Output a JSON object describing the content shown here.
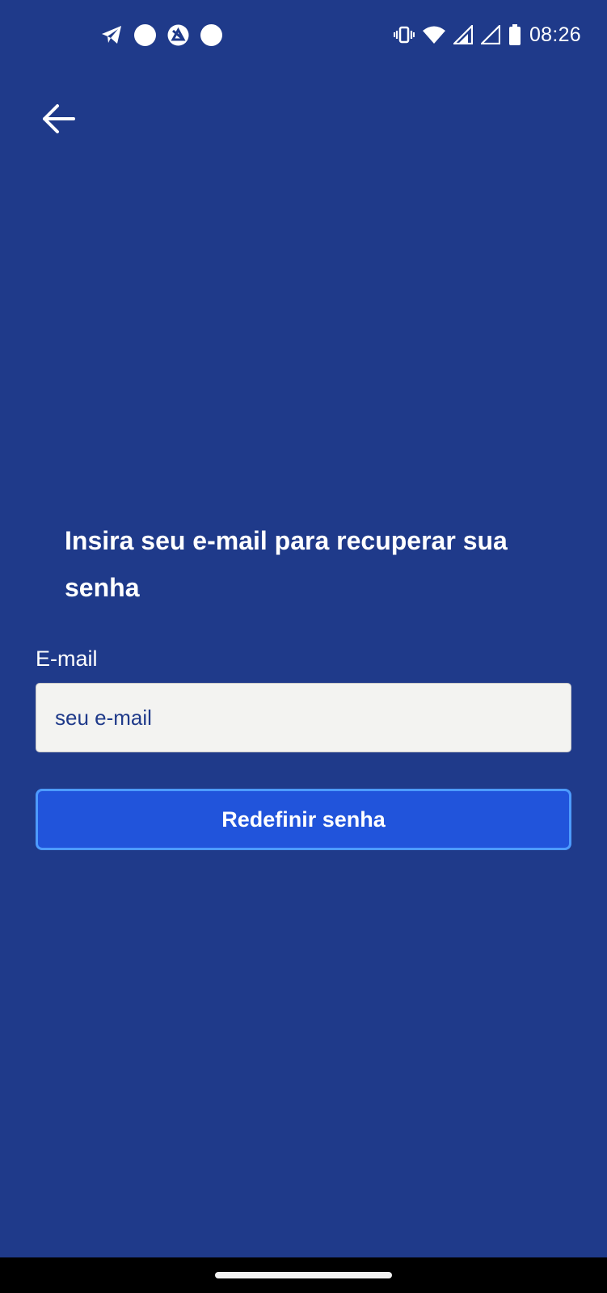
{
  "status_bar": {
    "time": "08:26",
    "left_icons": [
      "telegram-icon",
      "circle-notification-icon",
      "app-notification-icon",
      "circle-notification-icon"
    ],
    "right_icons": [
      "vibrate-icon",
      "wifi-icon",
      "signal-icon",
      "signal-empty-icon",
      "battery-icon"
    ]
  },
  "header": {
    "back_icon": "arrow-left-icon"
  },
  "main": {
    "heading": "Insira seu e-mail para recuperar sua senha",
    "email_label": "E-mail",
    "email_placeholder": "seu e-mail",
    "email_value": "",
    "submit_label": "Redefinir senha"
  },
  "colors": {
    "background": "#1f3a8a",
    "button": "#2154db",
    "button_border": "#4d9bff",
    "input_bg": "#f3f3f1",
    "text": "#ffffff"
  }
}
